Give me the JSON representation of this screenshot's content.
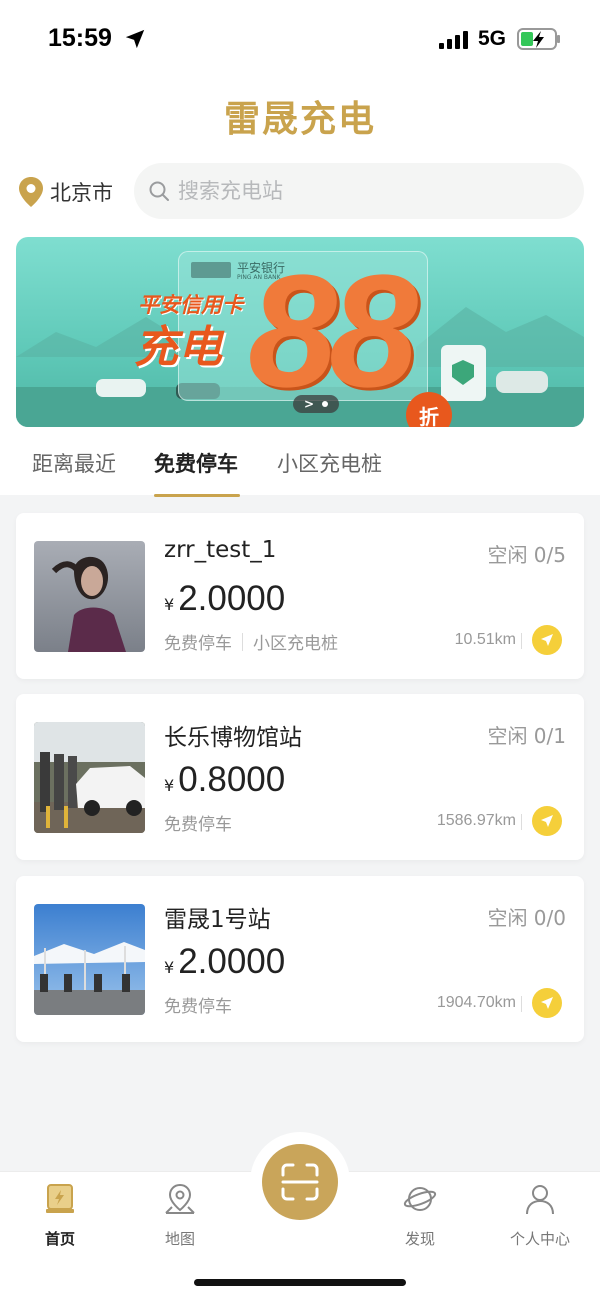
{
  "status_bar": {
    "time": "15:59",
    "network": "5G"
  },
  "app": {
    "title": "雷晟充电"
  },
  "location": {
    "city": "北京市"
  },
  "search": {
    "placeholder": "搜索充电站"
  },
  "banner": {
    "bank_name": "平安银行",
    "bank_name_en": "PING AN BANK",
    "line1": "平安信用卡",
    "line2": "充电",
    "discount_number": "88",
    "discount_unit": "折"
  },
  "tabs": [
    {
      "label": "距离最近",
      "active": false
    },
    {
      "label": "免费停车",
      "active": true
    },
    {
      "label": "小区充电桩",
      "active": false
    }
  ],
  "stations": [
    {
      "name": "zrr_test_1",
      "status": "空闲 0/5",
      "currency": "¥",
      "price": "2.0000",
      "tags": [
        "免费停车",
        "小区充电桩"
      ],
      "distance": "10.51km"
    },
    {
      "name": "长乐博物馆站",
      "status": "空闲 0/1",
      "currency": "¥",
      "price": "0.8000",
      "tags": [
        "免费停车"
      ],
      "distance": "1586.97km"
    },
    {
      "name": "雷晟1号站",
      "status": "空闲 0/0",
      "currency": "¥",
      "price": "2.0000",
      "tags": [
        "免费停车"
      ],
      "distance": "1904.70km"
    }
  ],
  "bottom_nav": [
    {
      "label": "首页",
      "icon": "home-charger-icon",
      "active": true
    },
    {
      "label": "地图",
      "icon": "map-pin-icon",
      "active": false
    },
    {
      "label": "发现",
      "icon": "planet-icon",
      "active": false
    },
    {
      "label": "个人中心",
      "icon": "person-icon",
      "active": false
    }
  ],
  "colors": {
    "accent": "#c9a34d",
    "nav_button": "#f5cf3a",
    "scan_button": "#c9a55a"
  }
}
